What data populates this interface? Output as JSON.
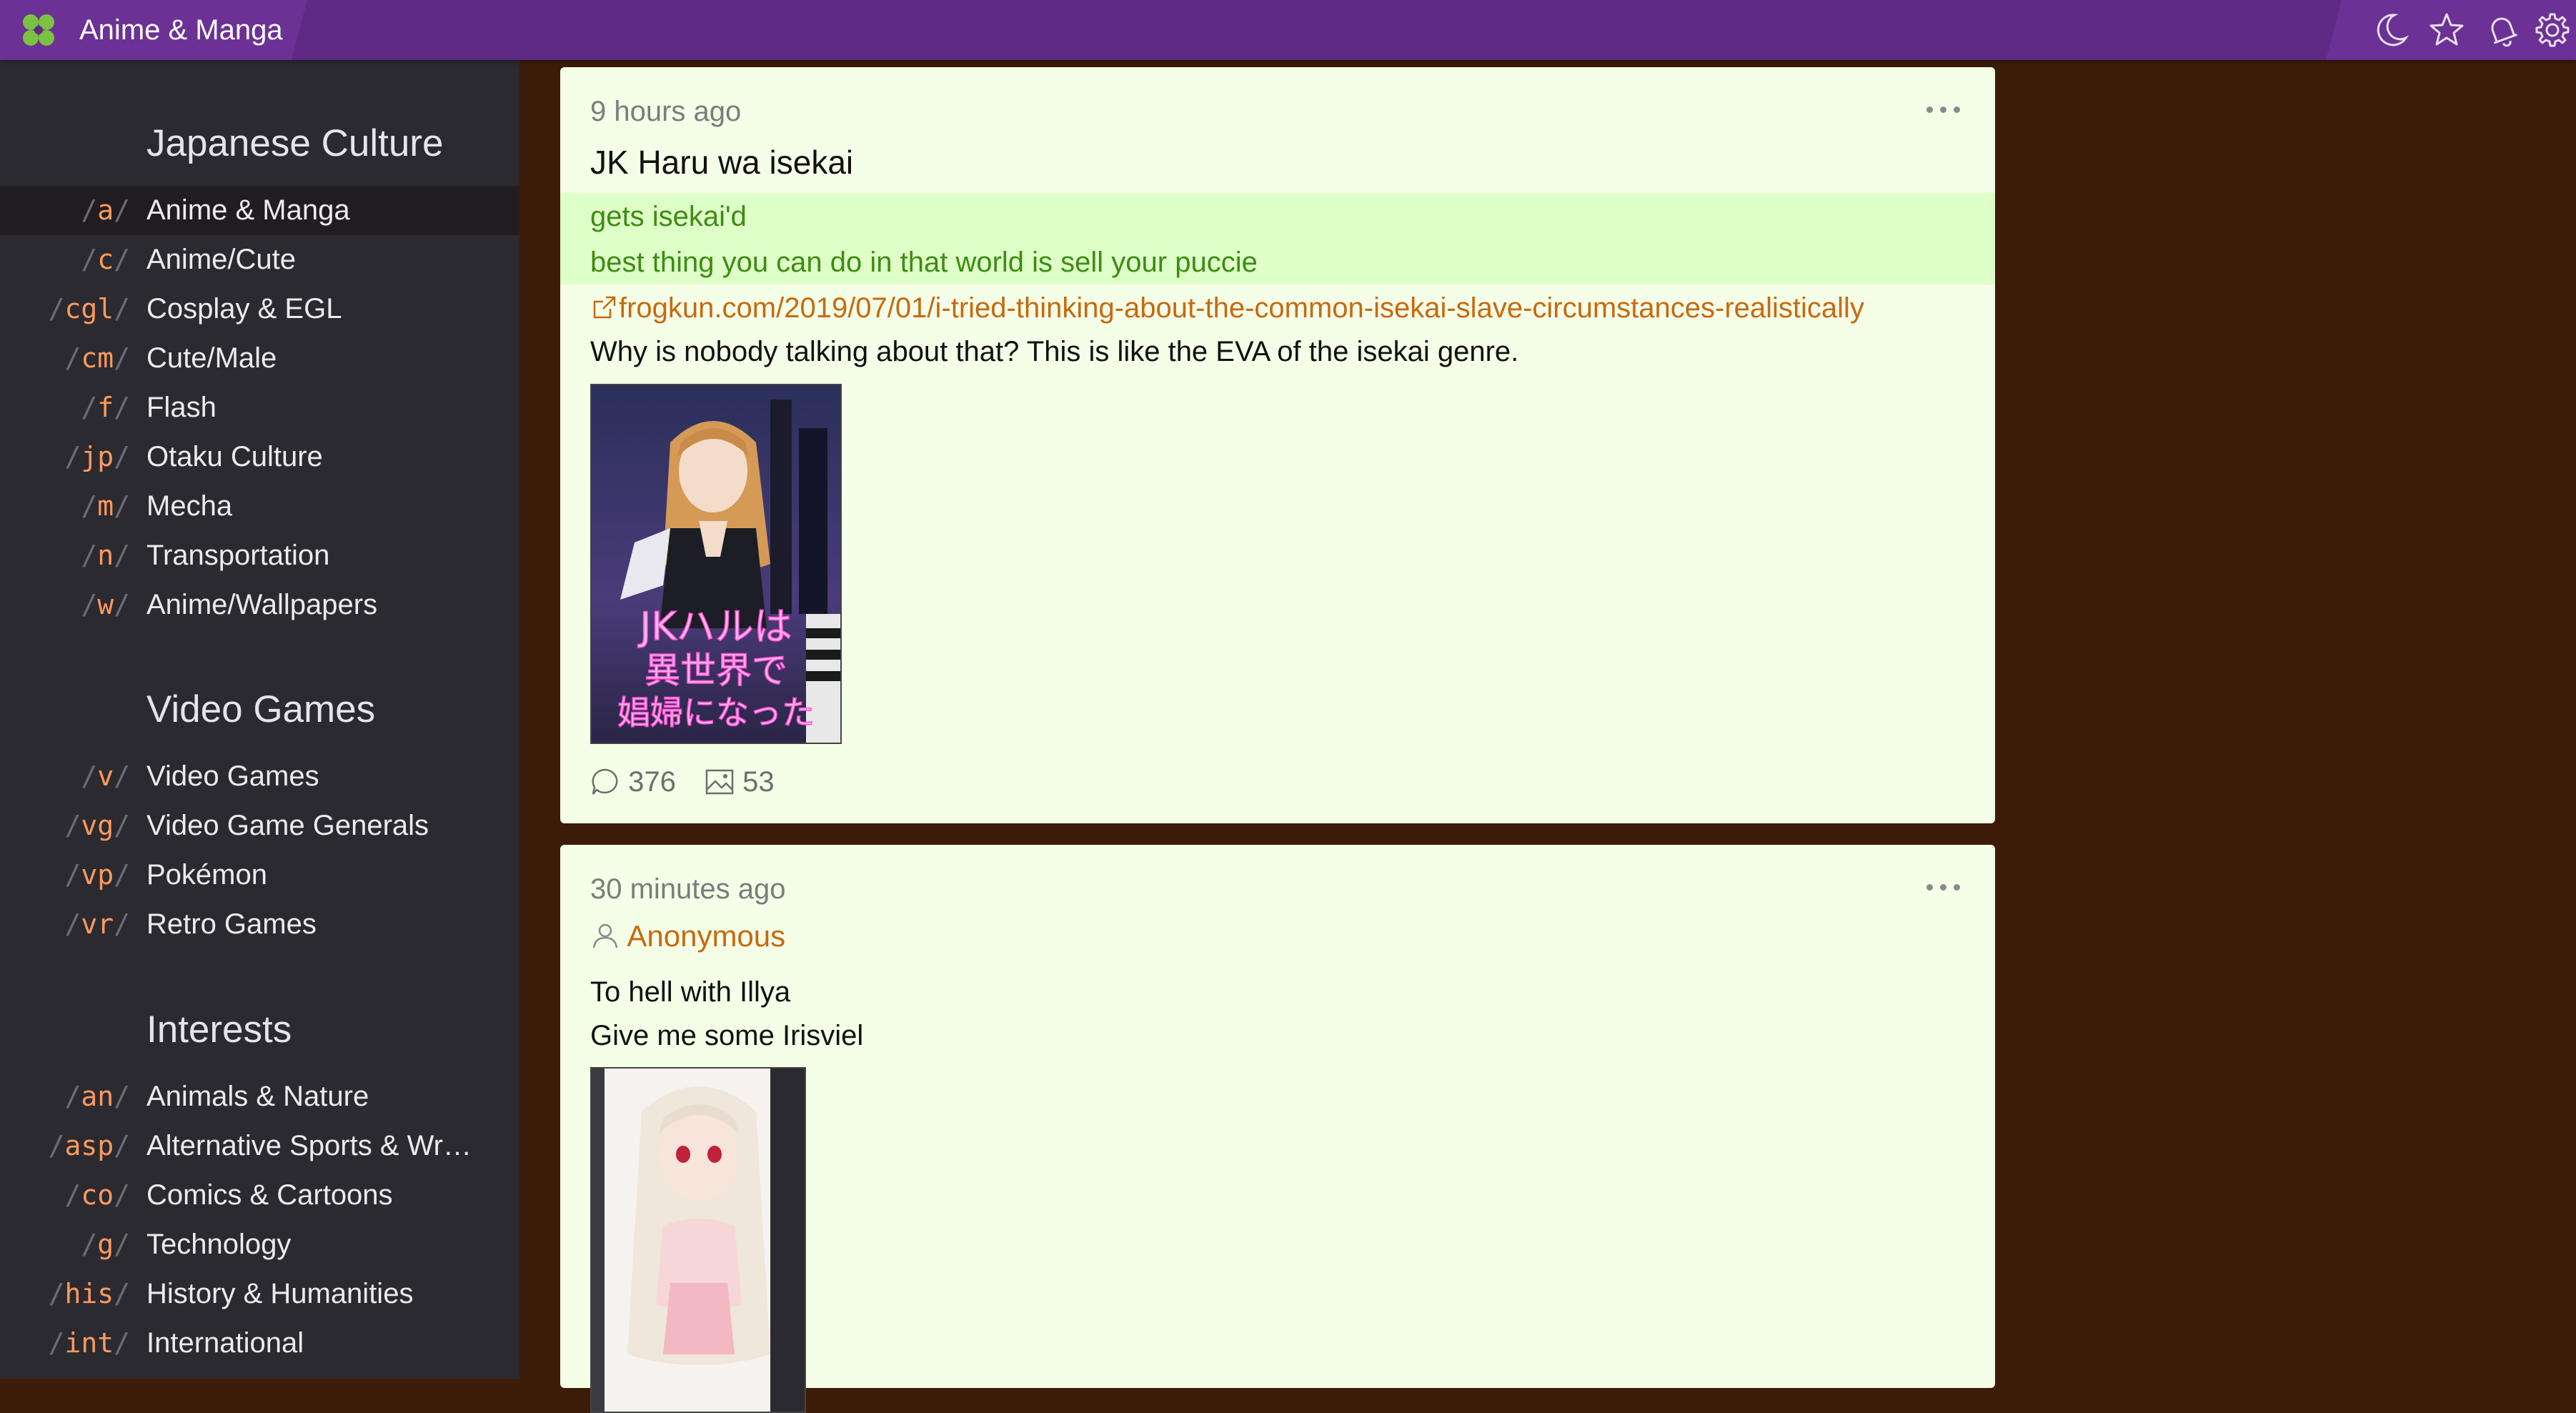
{
  "header": {
    "title": "Anime & Manga",
    "icons": [
      "clover-logo-icon",
      "moon-icon",
      "star-icon",
      "bell-icon",
      "gear-icon"
    ]
  },
  "sidebar": {
    "categories": [
      {
        "title": "Japanese Culture",
        "boards": [
          {
            "code": "a",
            "name": "Anime & Manga",
            "active": true
          },
          {
            "code": "c",
            "name": "Anime/Cute"
          },
          {
            "code": "cgl",
            "name": "Cosplay & EGL"
          },
          {
            "code": "cm",
            "name": "Cute/Male"
          },
          {
            "code": "f",
            "name": "Flash"
          },
          {
            "code": "jp",
            "name": "Otaku Culture"
          },
          {
            "code": "m",
            "name": "Mecha"
          },
          {
            "code": "n",
            "name": "Transportation"
          },
          {
            "code": "w",
            "name": "Anime/Wallpapers"
          }
        ]
      },
      {
        "title": "Video Games",
        "boards": [
          {
            "code": "v",
            "name": "Video Games"
          },
          {
            "code": "vg",
            "name": "Video Game Generals"
          },
          {
            "code": "vp",
            "name": "Pokémon"
          },
          {
            "code": "vr",
            "name": "Retro Games"
          }
        ]
      },
      {
        "title": "Interests",
        "boards": [
          {
            "code": "an",
            "name": "Animals & Nature"
          },
          {
            "code": "asp",
            "name": "Alternative Sports & Wrestling"
          },
          {
            "code": "co",
            "name": "Comics & Cartoons"
          },
          {
            "code": "g",
            "name": "Technology"
          },
          {
            "code": "his",
            "name": "History & Humanities"
          },
          {
            "code": "int",
            "name": "International"
          }
        ]
      }
    ]
  },
  "posts": [
    {
      "time": "9 hours ago",
      "subject": "JK Haru wa isekai",
      "greentext": [
        "gets isekai'd",
        "best thing you can do in that world is sell your puccie"
      ],
      "link": "frogkun.com/2019/07/01/i-tried-thinking-about-the-common-isekai-slave-circumstances-realistically",
      "body": [
        "Why is nobody talking about that? This is like the EVA of the isekai genre."
      ],
      "cover_text": [
        "JKハルは",
        "異世界で",
        "娼婦になった"
      ],
      "replies": "376",
      "images": "53"
    },
    {
      "time": "30 minutes ago",
      "author": "Anonymous",
      "body": [
        "To hell with Illya",
        "Give me some Irisviel"
      ]
    }
  ],
  "colors": {
    "topbar": "#5e2a86",
    "sidebar": "#2b2a30",
    "page_bg": "#3c1c08",
    "post_bg": "#f5ffe8",
    "greentext": "#3d8c14",
    "link": "#c8690e",
    "board_code": "#ff9a5e"
  }
}
